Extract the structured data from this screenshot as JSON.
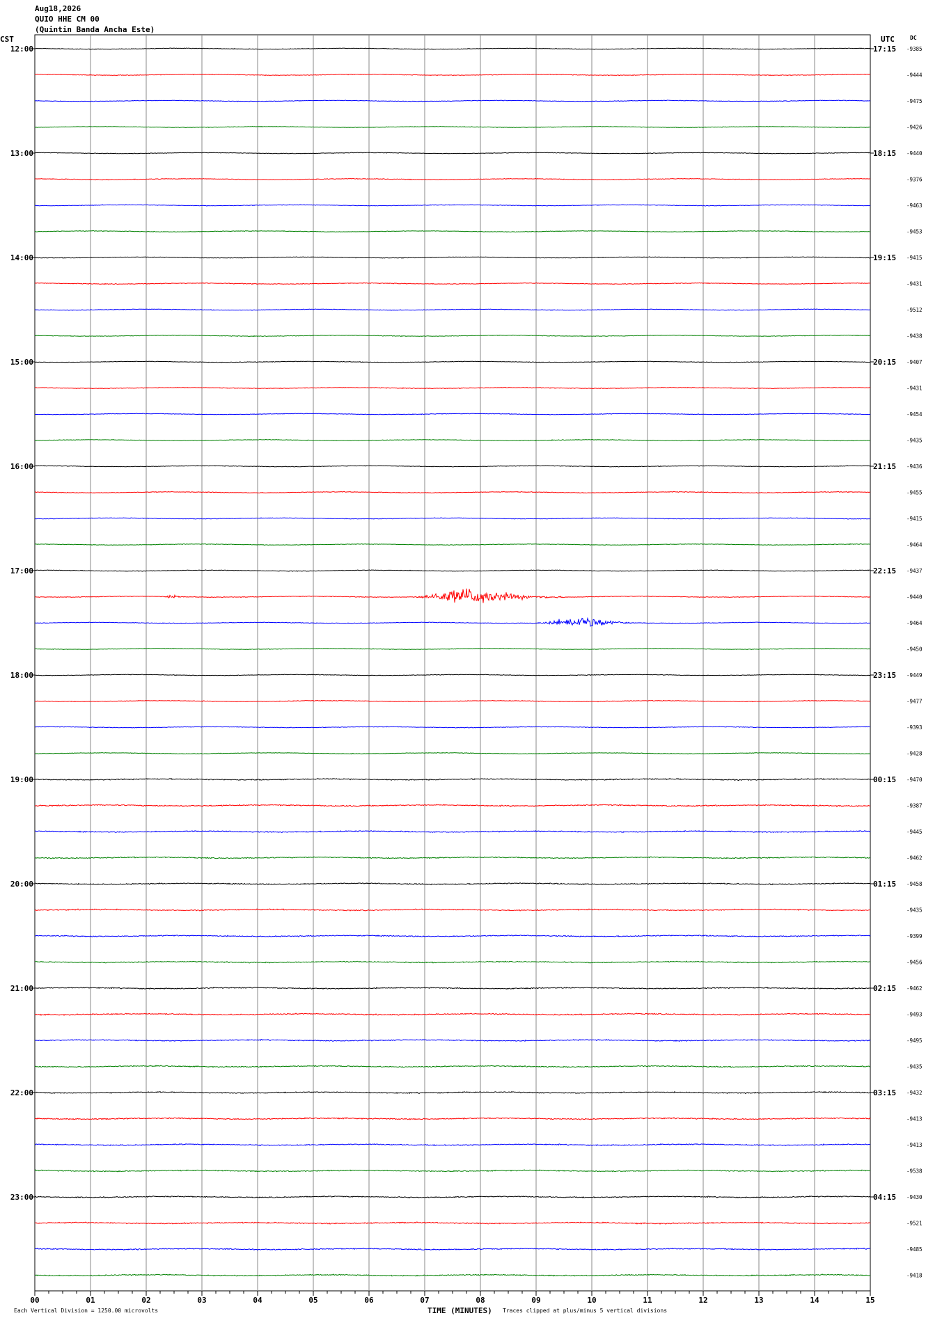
{
  "header": {
    "date": "Aug18,2026",
    "station": "QUIO HHE CM 00",
    "site": "(Quintin Banda Ancha Este)",
    "left_tz": "CST",
    "right_tz": "UTC",
    "dc_label": "DC"
  },
  "footer": {
    "division_note": "Each Vertical Division = 1250.00 microvolts",
    "xlabel": "TIME (MINUTES)",
    "clip_note": "Traces clipped at plus/minus 5 vertical divisions"
  },
  "chart_data": {
    "type": "line",
    "title": "Aug18,2026 QUIO HHE CM 00 (Quintin Banda Ancha Este)",
    "xlabel": "TIME (MINUTES)",
    "ylabel": "",
    "xlim": [
      0,
      15
    ],
    "x_ticks": [
      "00",
      "01",
      "02",
      "03",
      "04",
      "05",
      "06",
      "07",
      "08",
      "09",
      "10",
      "11",
      "12",
      "13",
      "14",
      "15"
    ],
    "grid": true,
    "trace_colors": [
      "#000000",
      "#ff0000",
      "#0000ff",
      "#008000"
    ],
    "hour_labels_cst": [
      "12:00",
      "13:00",
      "14:00",
      "15:00",
      "16:00",
      "17:00",
      "18:00",
      "19:00",
      "20:00",
      "21:00",
      "22:00",
      "23:00"
    ],
    "hour_labels_utc": [
      "17:15",
      "18:15",
      "19:15",
      "20:15",
      "21:15",
      "22:15",
      "23:15",
      "00:15",
      "01:15",
      "02:15",
      "03:15",
      "04:15"
    ],
    "dc_values": [
      "-9385",
      "-9444",
      "-9475",
      "-9426",
      "-9440",
      "-9376",
      "-9463",
      "-9453",
      "-9415",
      "-9431",
      "-9512",
      "-9438",
      "-9407",
      "-9431",
      "-9454",
      "-9435",
      "-9436",
      "-9455",
      "-9415",
      "-9464",
      "-9437",
      "-9440",
      "-9464",
      "-9450",
      "-9449",
      "-9477",
      "-9393",
      "-9428",
      "-9470",
      "-9387",
      "-9445",
      "-9462",
      "-9458",
      "-9435",
      "-9399",
      "-9456",
      "-9462",
      "-9493",
      "-9495",
      "-9435",
      "-9432",
      "-9413",
      "-9413",
      "-9538",
      "-9430",
      "-9521",
      "-9485",
      "-9418"
    ],
    "events": [
      {
        "trace": 21,
        "start_min": 6.8,
        "peak_min": 7.9,
        "end_min": 9.5,
        "amplitude_div": 1.2
      },
      {
        "trace": 21,
        "start_min": 2.3,
        "peak_min": 2.5,
        "end_min": 2.7,
        "amplitude_div": 0.3
      },
      {
        "trace": 22,
        "start_min": 9.0,
        "peak_min": 10.0,
        "end_min": 10.8,
        "amplitude_div": 0.8
      }
    ]
  }
}
